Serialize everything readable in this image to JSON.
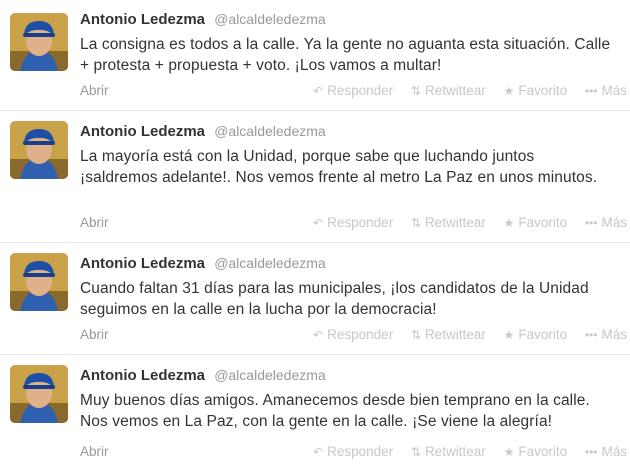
{
  "tweets": [
    {
      "name": "Antonio Ledezma",
      "handle": "@alcaldeledezma",
      "text": "La consigna es todos a la calle. Ya la gente no aguanta esta situación. Calle + protesta + propuesta + voto. ¡Los vamos a multar!",
      "open": "Abrir",
      "actions": {
        "reply": "Responder",
        "retweet": "Retwittear",
        "favorite": "Favorito",
        "more": "Más"
      }
    },
    {
      "name": "Antonio Ledezma",
      "handle": "@alcaldeledezma",
      "text": "La mayoría está con la Unidad, porque sabe que luchando juntos ¡saldremos adelante!. Nos vemos frente al metro La Paz en unos minutos.",
      "open": "Abrir",
      "actions": {
        "reply": "Responder",
        "retweet": "Retwittear",
        "favorite": "Favorito",
        "more": "Más"
      }
    },
    {
      "name": "Antonio Ledezma",
      "handle": "@alcaldeledezma",
      "text": "Cuando faltan 31 días para las  municipales, ¡los candidatos de la Unidad seguimos en la calle en la lucha por la democracia!",
      "open": "Abrir",
      "actions": {
        "reply": "Responder",
        "retweet": "Retwittear",
        "favorite": "Favorito",
        "more": "Más"
      }
    },
    {
      "name": "Antonio Ledezma",
      "handle": "@alcaldeledezma",
      "text": "Muy buenos días amigos. Amanecemos desde bien temprano en la calle. Nos vemos en La Paz, con la gente en la calle. ¡Se viene la alegría!",
      "open": "Abrir",
      "actions": {
        "reply": "Responder",
        "retweet": "Retwittear",
        "favorite": "Favorito",
        "more": "Más"
      }
    }
  ],
  "icons": {
    "reply": "reply-icon",
    "retweet": "retweet-icon",
    "favorite": "star-icon",
    "more": "more-dots-icon"
  },
  "colors": {
    "name": "#333333",
    "muted": "#999999",
    "action": "#c8c8c8",
    "divider": "#e6e6e6"
  }
}
